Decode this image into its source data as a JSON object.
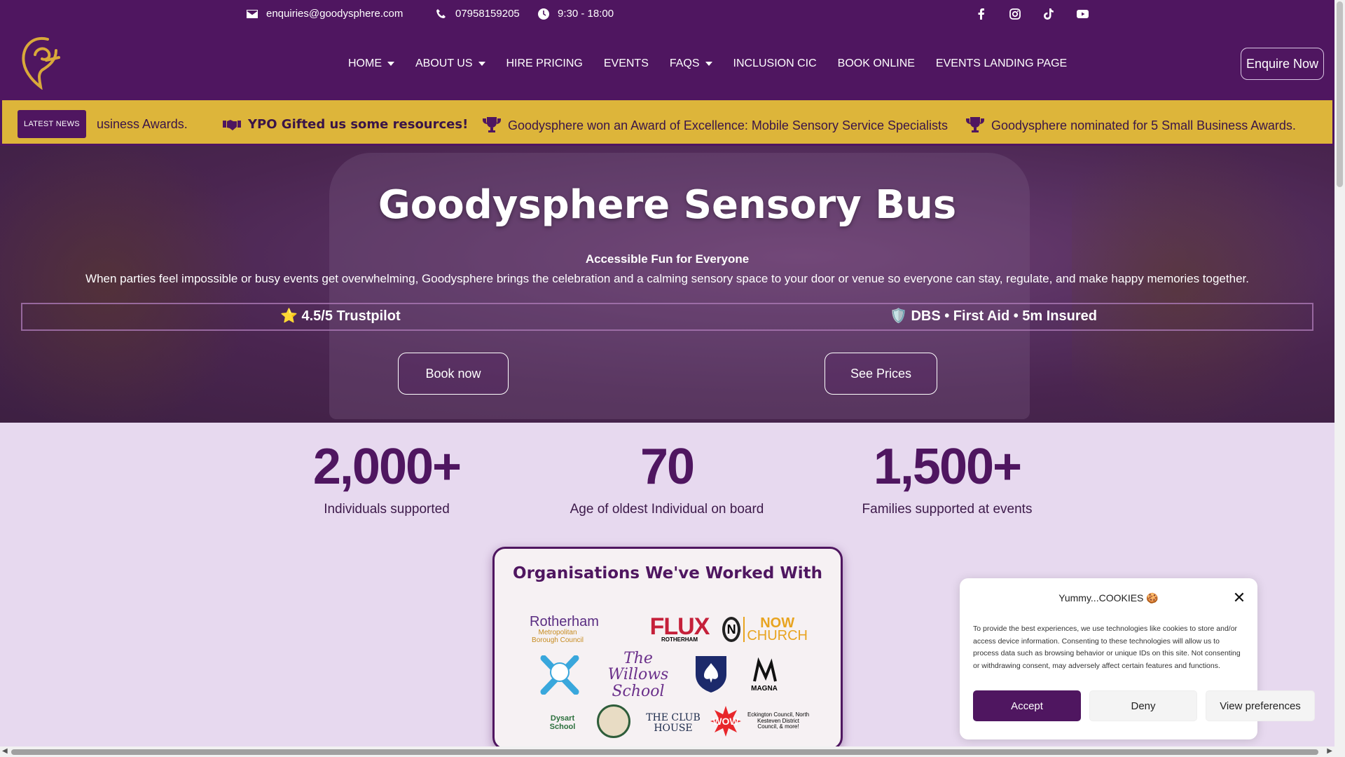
{
  "topbar": {
    "email": "enquiries@goodysphere.com",
    "phone": "07958159205",
    "hours": "9:30 - 18:00",
    "social": [
      "facebook-icon",
      "instagram-icon",
      "tiktok-icon",
      "youtube-icon"
    ]
  },
  "nav": {
    "items": [
      {
        "label": "HOME",
        "dropdown": true
      },
      {
        "label": "ABOUT US",
        "dropdown": true
      },
      {
        "label": "HIRE PRICING",
        "dropdown": false
      },
      {
        "label": "EVENTS",
        "dropdown": false
      },
      {
        "label": "FAQS",
        "dropdown": true
      },
      {
        "label": "INCLUSION CIC",
        "dropdown": false
      },
      {
        "label": "BOOK ONLINE",
        "dropdown": false
      },
      {
        "label": "EVENTS LANDING PAGE",
        "dropdown": false
      }
    ],
    "cta": "Enquire Now"
  },
  "news": {
    "badge": "LATEST NEWS",
    "items": [
      "usiness Awards.",
      "YPO Gifted us some resources!",
      "Goodysphere won an Award of Excellence: Mobile Sensory Service Specialists",
      "Goodysphere nominated for 5 Small Business Awards."
    ]
  },
  "hero": {
    "title": "Goodysphere Sensory Bus",
    "subtitle": "Accessible Fun for Everyone",
    "description": "When parties feel impossible or busy events get overwhelming, Goodysphere brings the celebration and a calming sensory space to your door or venue so everyone can stay, regulate, and make happy memories together.",
    "trust_left": "⭐ 4.5/5 Trustpilot",
    "trust_right": "🛡️ DBS • First Aid • 5m Insured",
    "btn_book": "Book now",
    "btn_prices": "See Prices"
  },
  "stats": [
    {
      "value": "2,000+",
      "label": "Individuals supported"
    },
    {
      "value": "70",
      "label": "Age of oldest Individual on board"
    },
    {
      "value": "1,500+",
      "label": "Families supported at events"
    }
  ],
  "orgs": {
    "title": "Organisations We've Worked With",
    "logos": {
      "rotherham_top": "Rotherham",
      "rotherham_bottom": "Metropolitan Borough Council",
      "flux": "FLUX",
      "flux_sub": "ROTHERHAM",
      "now_a": "NOW",
      "now_b": "CHURCH",
      "willows": "The Willows School",
      "magna": "MAGNA",
      "dysart": "Dysart School",
      "clubhouse": "THE CLUB HOUSE",
      "wow": "WOW",
      "eckington": "Eckington Council, North Kesteven District Council, & more!"
    }
  },
  "cookie": {
    "title": "Yummy...COOKIES 🍪",
    "text": "To provide the best experiences, we use technologies like cookies to store and/or access device information. Consenting to these technologies will allow us to process data such as browsing behavior or unique IDs on this site. Not consenting or withdrawing consent, may adversely affect certain features and functions.",
    "accept": "Accept",
    "deny": "Deny",
    "prefs": "View preferences"
  },
  "colors": {
    "brand_purple": "#4f1660",
    "news_gold": "#ddb53a",
    "page_lilac": "#e7d9ef"
  }
}
